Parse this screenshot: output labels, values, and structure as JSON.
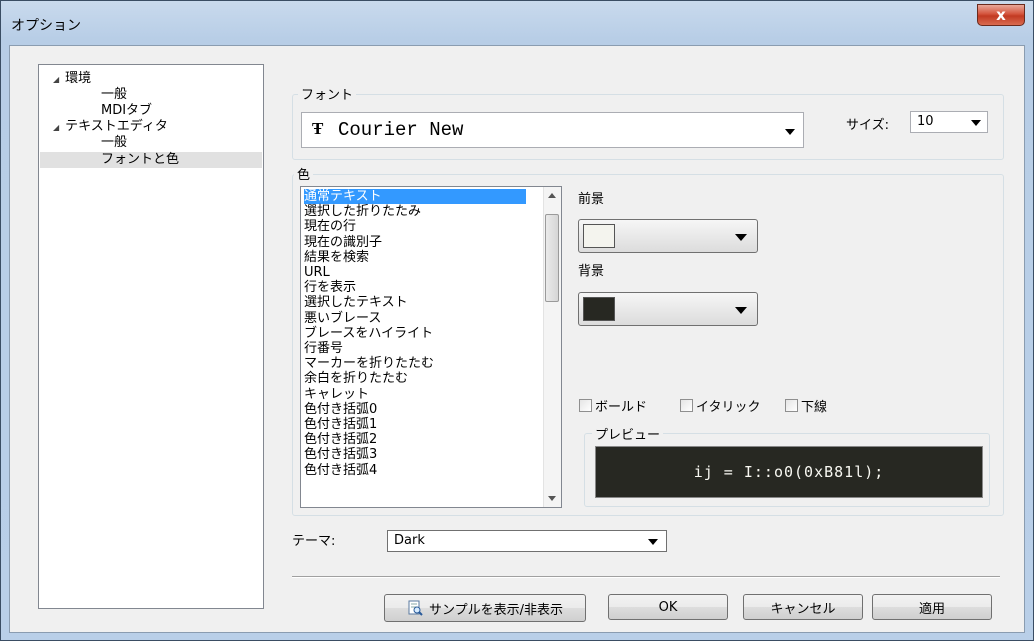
{
  "window": {
    "title": "オプション",
    "close_label": "x"
  },
  "tree": {
    "items": [
      {
        "label": "環境",
        "level": 0,
        "expanded": true
      },
      {
        "label": "一般",
        "level": 1
      },
      {
        "label": "MDIタブ",
        "level": 1
      },
      {
        "label": "テキストエディタ",
        "level": 0,
        "expanded": true
      },
      {
        "label": "一般",
        "level": 1
      },
      {
        "label": "フォントと色",
        "level": 1,
        "selected": true
      }
    ]
  },
  "font_group": {
    "label": "フォント",
    "font_value": "Courier New",
    "font_icon": "truetype-font-icon",
    "size_label": "サイズ:",
    "size_value": "10"
  },
  "color_group": {
    "label": "色",
    "items": [
      "通常テキスト",
      "選択した折りたたみ",
      "現在の行",
      "現在の識別子",
      "結果を検索",
      "URL",
      "行を表示",
      "選択したテキスト",
      "悪いブレース",
      "ブレースをハイライト",
      "行番号",
      "マーカーを折りたたむ",
      "余白を折りたたむ",
      "キャレット",
      "色付き括弧0",
      "色付き括弧1",
      "色付き括弧2",
      "色付き括弧3",
      "色付き括弧4"
    ],
    "selected_index": 0,
    "foreground_label": "前景",
    "foreground_color": "#f4f4ee",
    "background_label": "背景",
    "background_color": "#272822",
    "bold_label": "ボールド",
    "italic_label": "イタリック",
    "underline_label": "下線",
    "preview_label": "プレビュー",
    "preview_text": "ij = I::o0(0xB81l);"
  },
  "theme": {
    "label": "テーマ:",
    "value": "Dark"
  },
  "buttons": {
    "sample_label": "サンプルを表示/非表示",
    "ok_label": "OK",
    "cancel_label": "キャンセル",
    "apply_label": "適用"
  }
}
